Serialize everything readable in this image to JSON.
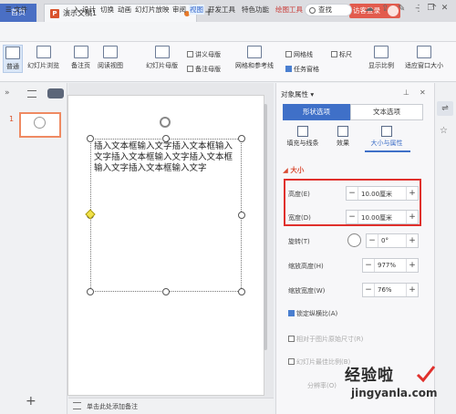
{
  "titlebar": {
    "home_tab": "首页",
    "doc_tab": "演示文稿1",
    "add_tab": "+",
    "page_indicator": "1",
    "visitor_login": "访客登录",
    "window_buttons": [
      "–",
      "❐",
      "✕"
    ]
  },
  "menu": {
    "file": "☰ 文件",
    "items": [
      "入",
      "设计",
      "切换",
      "动画",
      "幻灯片放映",
      "审阅",
      "视图",
      "开发工具",
      "特色功能",
      "绘图工具"
    ],
    "active": "视图",
    "search": "查找"
  },
  "ribbon": {
    "normal": "普通",
    "slide_browse": "幻灯片浏览",
    "notes_page": "备注页",
    "reading_view": "阅读视图",
    "slide_master": "幻灯片母版",
    "handout_master": "讲义母版",
    "notes_master": "备注母版",
    "grid_guides": "网格和参考线",
    "gridlines": "网格线",
    "ruler": "标尺",
    "task_pane": "任务窗格",
    "zoom": "显示比例",
    "fit_window": "适应窗口大小"
  },
  "slides": {
    "number": "1"
  },
  "shape_text": "插入文本框输入文字插入文本框输入文字插入文本框输入文字插入文本框输入文字插入文本框输入文字",
  "notes_placeholder": "单击此处添加备注",
  "props": {
    "title": "对象属性 ▾",
    "tab_shape": "形状选项",
    "tab_text": "文本选项",
    "subtabs": [
      "填充与线条",
      "效果",
      "大小与属性"
    ],
    "section": "◢ 大小",
    "height_label": "高度(E)",
    "height_value": "10.00厘米",
    "width_label": "宽度(D)",
    "width_value": "10.00厘米",
    "rotate_label": "旋转(T)",
    "rotate_value": "0°",
    "scale_h_label": "缩放高度(H)",
    "scale_h_value": "977%",
    "scale_w_label": "缩放宽度(W)",
    "scale_w_value": "76%",
    "lock_ratio": "锁定纵横比(A)",
    "relative_original": "相对于图片原始尺寸(R)",
    "best_scale": "幻灯片最佳比例(B)",
    "resolution": "分辨率(O)"
  },
  "watermark": {
    "line1": "经验啦",
    "line2": "jingyanla.com"
  },
  "colors": {
    "accent": "#3f70c8",
    "highlight_box": "#e0302c",
    "section_title": "#d94b33",
    "visitor": "#e25b4d"
  }
}
